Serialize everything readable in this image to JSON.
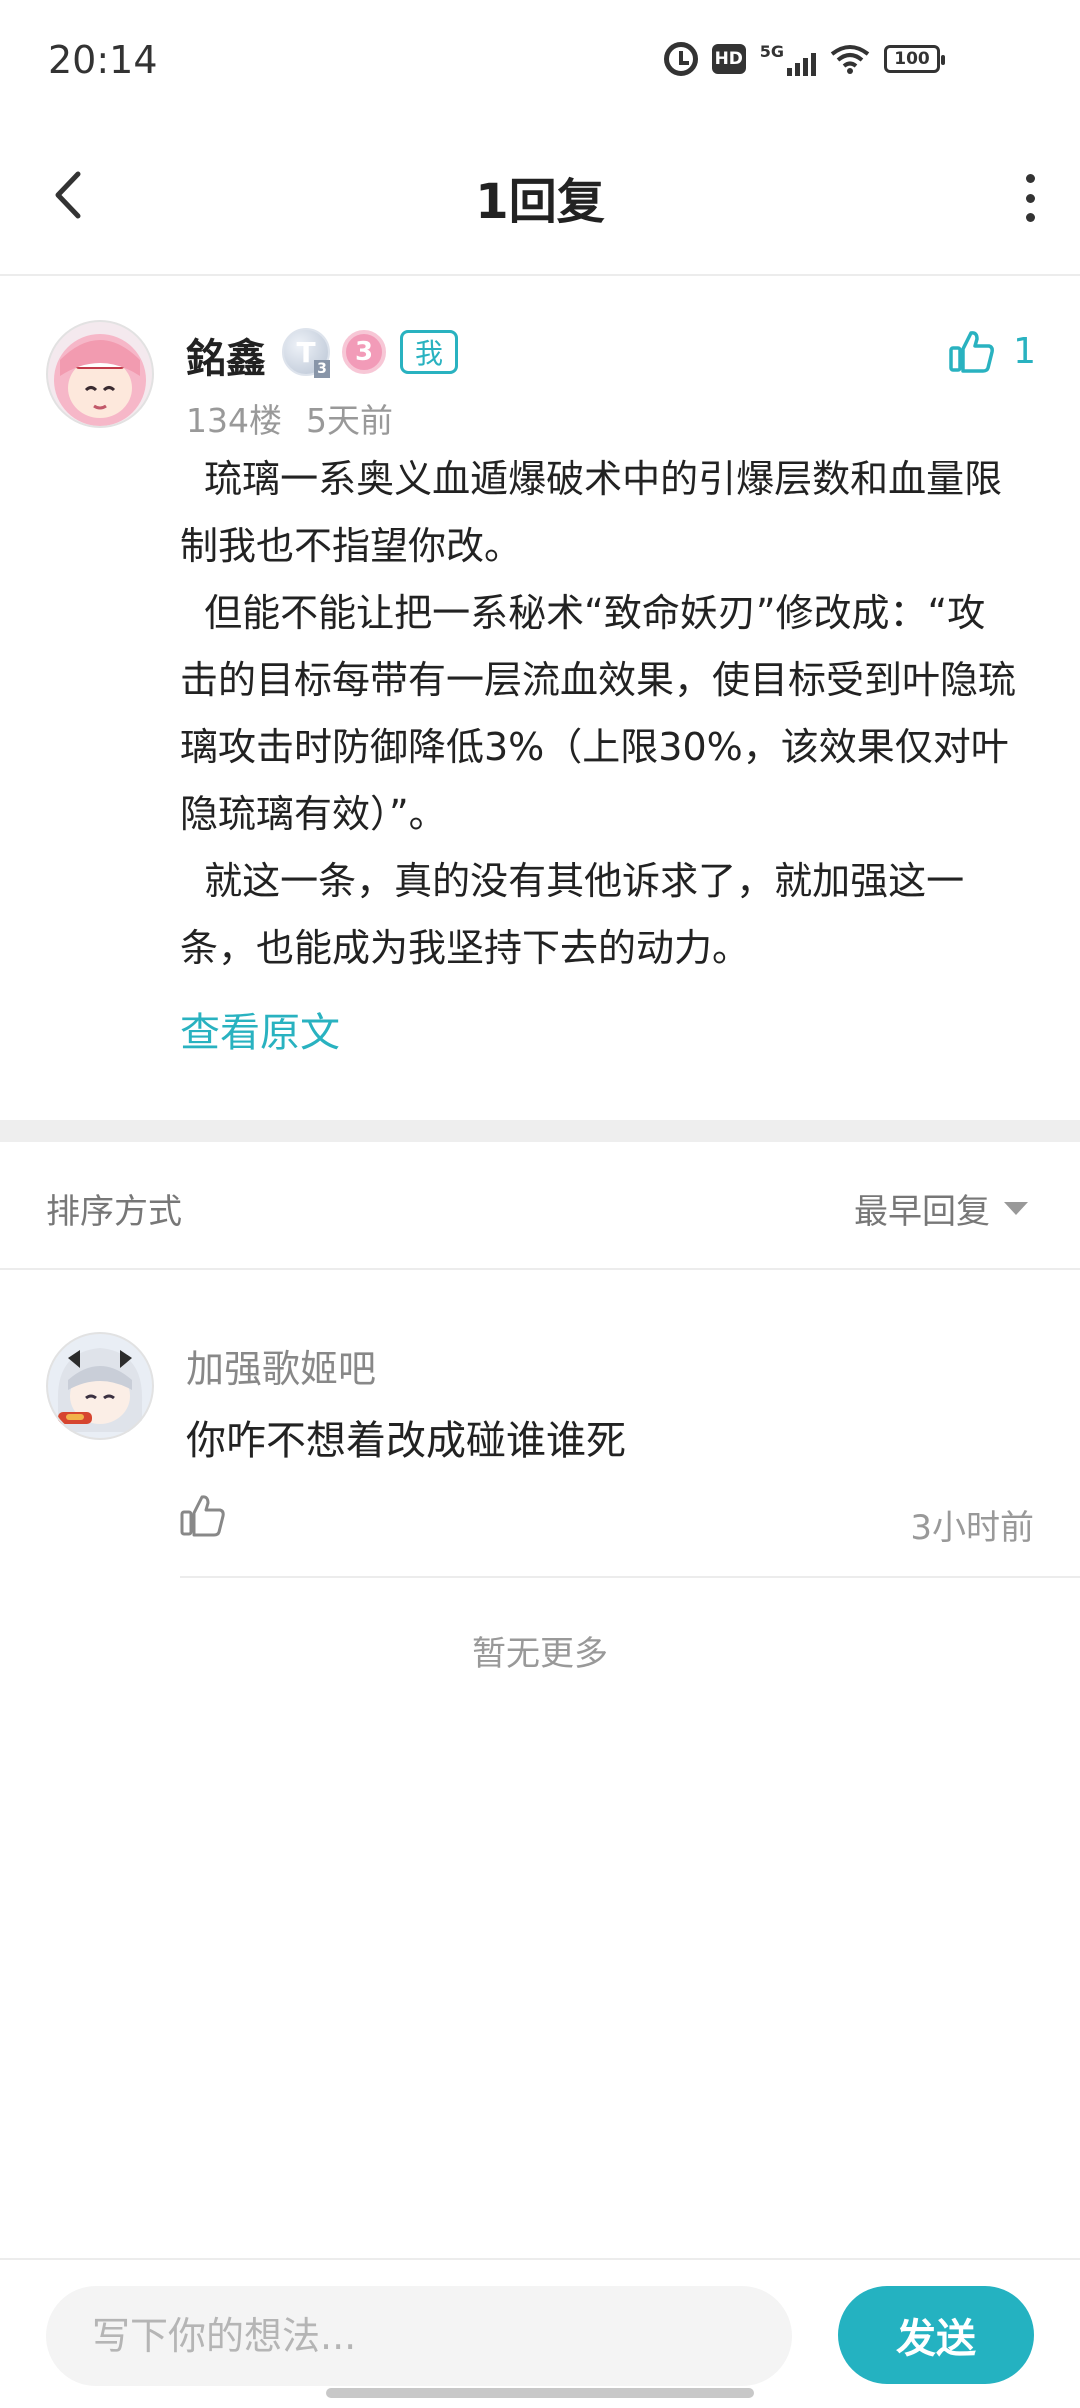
{
  "status_bar": {
    "time": "20:14",
    "hd_label": "HD",
    "network_label": "5G",
    "battery_level": "100"
  },
  "header": {
    "title": "1回复"
  },
  "post": {
    "username": "銘鑫",
    "level_badge": "T",
    "level_sub": "3",
    "pink_badge": "3",
    "me_tag": "我",
    "like_count": "1",
    "floor": "134楼",
    "time": "5天前",
    "paragraphs": [
      "  琉璃一系奥义血遁爆破术中的引爆层数和血量限制我也不指望你改。",
      "  但能不能让把一系秘术“致命妖刃”修改成：“攻击的目标每带有一层流血效果，使目标受到叶隐琉璃攻击时防御降低3%（上限30%，该效果仅对叶隐琉璃有效）”。",
      "  就这一条，真的没有其他诉求了，就加强这一条，也能成为我坚持下去的动力。"
    ],
    "view_original": "查看原文"
  },
  "sort": {
    "label": "排序方式",
    "value": "最早回复"
  },
  "replies": [
    {
      "username": "加强歌姬吧",
      "text": "你咋不想着改成碰谁谁死",
      "time": "3小时前"
    }
  ],
  "no_more": "暂无更多",
  "composer": {
    "placeholder": "写下你的想法...",
    "send_label": "发送"
  },
  "colors": {
    "accent": "#29b2c0",
    "send_button": "#24b2c1",
    "muted_text": "#999999"
  }
}
